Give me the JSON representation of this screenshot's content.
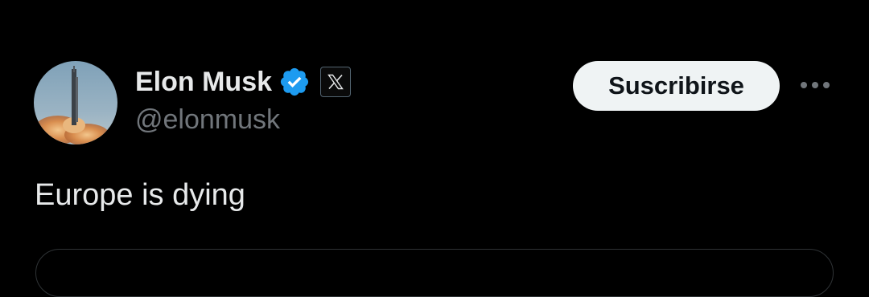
{
  "tweet": {
    "author": {
      "display_name": "Elon Musk",
      "handle": "@elonmusk",
      "verified_icon": "verified-badge-icon",
      "affiliate_icon": "x-logo-icon"
    },
    "subscribe_label": "Suscribirse",
    "more_icon": "more-options-icon",
    "text": "Europe is dying"
  },
  "colors": {
    "background": "#000000",
    "primary_text": "#e7e9ea",
    "secondary_text": "#71767b",
    "verified_blue": "#1d9bf0",
    "button_bg": "#eff3f4",
    "button_text": "#0f1419",
    "border": "#2f3336"
  }
}
